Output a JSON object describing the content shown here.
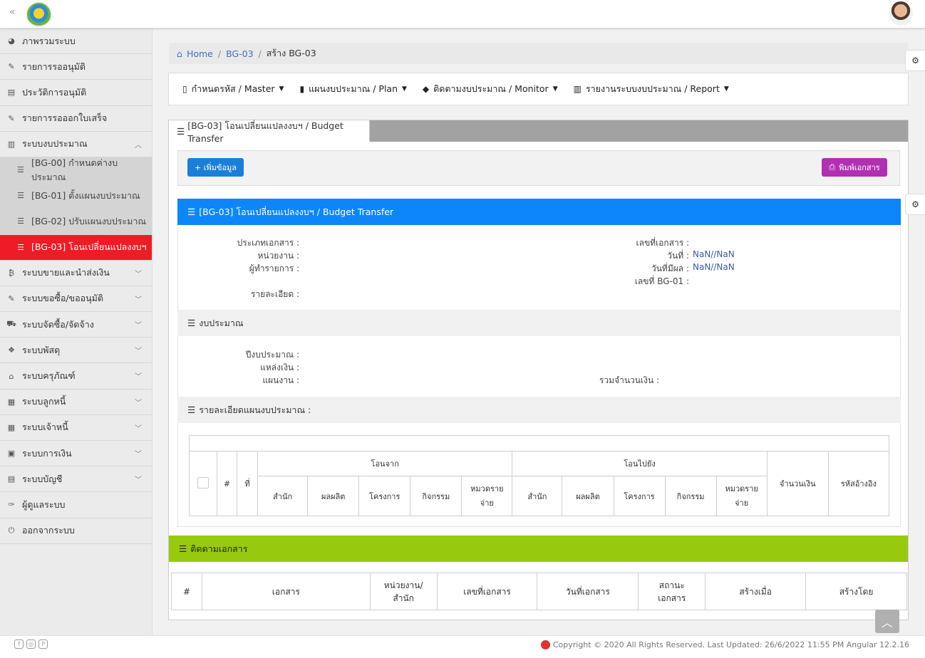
{
  "topbar": {
    "collapse_icon": "«"
  },
  "sidebar": {
    "items": [
      {
        "label": "ภาพรวมระบบ",
        "icon": "dashboard-icon"
      },
      {
        "label": "รายการรออนุมัติ",
        "icon": "edit-icon"
      },
      {
        "label": "ประวัติการอนุมัติ",
        "icon": "file-icon"
      },
      {
        "label": "รายการรอออกใบเสร็จ",
        "icon": "edit-icon"
      },
      {
        "label": "ระบบงบประมาณ",
        "icon": "bar-chart-icon",
        "expanded": true
      },
      {
        "label": "[BG-00] กำหนดค่างบประมาณ",
        "icon": "list-icon"
      },
      {
        "label": "[BG-01] ตั้งแผนงบประมาณ",
        "icon": "list-icon"
      },
      {
        "label": "[BG-02] ปรับแผนงบประมาณ",
        "icon": "list-icon"
      },
      {
        "label": "[BG-03] โอนเปลี่ยนแปลงงบฯ",
        "icon": "list-icon",
        "active": true
      },
      {
        "label": "ระบบขายและนำส่งเงิน",
        "icon": "bitcoin-icon"
      },
      {
        "label": "ระบบขอซื้อ/ขออนุมัติ",
        "icon": "edit-icon"
      },
      {
        "label": "ระบบจัดซื้อ/จัดจ้าง",
        "icon": "cart-icon"
      },
      {
        "label": "ระบบพัสดุ",
        "icon": "cubes-icon"
      },
      {
        "label": "ระบบครุภัณฑ์",
        "icon": "bank-icon"
      },
      {
        "label": "ระบบลูกหนี้",
        "icon": "grid-icon"
      },
      {
        "label": "ระบบเจ้าหนี้",
        "icon": "grid-small-icon"
      },
      {
        "label": "ระบบการเงิน",
        "icon": "money-icon"
      },
      {
        "label": "ระบบบัญชี",
        "icon": "calculator-icon"
      },
      {
        "label": "ผู้ดูแลระบบ",
        "icon": "wrench-icon"
      },
      {
        "label": "ออกจากระบบ",
        "icon": "power-icon"
      }
    ]
  },
  "breadcrumb": {
    "home": "Home",
    "sep": "/",
    "level1": "BG-03",
    "current": "สร้าง BG-03"
  },
  "menubar": {
    "master": "กำหนดรหัส / Master",
    "plan": "แผนงบประมาณ / Plan",
    "monitor": "ติดตามงบประมาณ / Monitor",
    "report": "รายงานระบบงบประมาณ / Report"
  },
  "tab": {
    "label": "[BG-03] โอนเปลี่ยนแปลงงบฯ / Budget Transfer"
  },
  "toolbar": {
    "add_label": "+ เพิ่มข้อมูล",
    "print_label": "พิมพ์เอกสาร"
  },
  "document": {
    "header": "[BG-03] โอนเปลี่ยนแปลงงบฯ / Budget Transfer",
    "doc_type_label": "ประเภทเอกสาร :",
    "unit_label": "หน่วยงาน :",
    "operator_label": "ผู้ทำรายการ :",
    "detail_label": "รายละเอียด :",
    "doc_no_label": "เลขที่เอกสาร :",
    "date_label": "วันที่ :",
    "date_value": "NaN//NaN",
    "effective_label": "วันที่มีผล :",
    "effective_value": "NaN//NaN",
    "bg01_label": "เลขที่ BG-01 :"
  },
  "budget": {
    "header": "งบประมาณ",
    "year_label": "ปีงบประมาณ :",
    "source_label": "แหล่งเงิน :",
    "plan_label": "แผนงาน :",
    "total_label": "รวมจำนวนเงิน :"
  },
  "plan_detail": {
    "header": "รายละเอียดแผนงบประมาณ :",
    "columns": {
      "hash": "#",
      "no": "ที่",
      "from": "โอนจาก",
      "to": "โอนไปยัง",
      "amount": "จำนวนเงิน",
      "ref": "รหัสอ้างอิง",
      "office": "สำนัก",
      "output": "ผลผลิต",
      "project": "โครงการ",
      "activity": "กิจกรรม",
      "category_1": "หมวดราย",
      "category_2": "จ่าย"
    }
  },
  "tracking": {
    "header": "ติดตามเอกสาร",
    "columns": {
      "hash": "#",
      "document": "เอกสาร",
      "unit_1": "หน่วยงาน/",
      "unit_2": "สำนัก",
      "doc_no": "เลขที่เอกสาร",
      "doc_date": "วันที่เอกสาร",
      "status_1": "สถานะ",
      "status_2": "เอกสาร",
      "created_at": "สร้างเมื่อ",
      "created_by": "สร้างโดย"
    }
  },
  "footer": {
    "copyright": "Copyright © 2020 All Rights Reserved. Last Updated: 26/6/2022 11:55 PM Angular 12.2.16"
  },
  "colors": {
    "active": "#ee1c25",
    "blue": "#0d86fb",
    "green": "#97ca0e",
    "purple": "#b22fb1",
    "add": "#1a7fd6"
  }
}
